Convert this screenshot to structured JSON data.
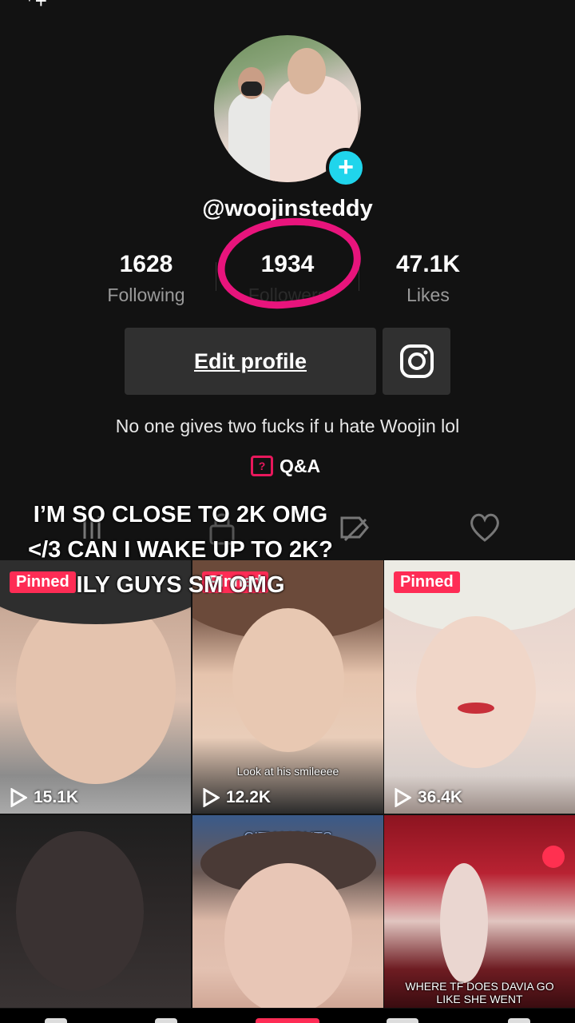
{
  "profile": {
    "username": "@woojinsteddy",
    "bio": "No one gives two fucks if u hate Woojin lol",
    "qa_label": "Q&A",
    "edit_profile_label": "Edit profile"
  },
  "stats": {
    "following": {
      "value": "1628",
      "label": "Following"
    },
    "followers": {
      "value": "1934",
      "label": "Followers"
    },
    "likes": {
      "value": "47.1K",
      "label": "Likes"
    }
  },
  "overlay_caption": "I’M SO CLOSE TO 2K OMG </3 CAN I WAKE UP TO 2K? ILY GUYS SM OMG",
  "tabs": [
    {
      "name": "videos-grid-icon"
    },
    {
      "name": "private-lock-icon"
    },
    {
      "name": "hidden-eye-icon"
    },
    {
      "name": "liked-heart-icon"
    }
  ],
  "videos": [
    {
      "pinned_label": "Pinned",
      "views": "15.1K",
      "caption": ""
    },
    {
      "pinned_label": "Pinned",
      "views": "12.2K",
      "caption": "Look at his smileeee"
    },
    {
      "pinned_label": "Pinned",
      "views": "36.4K",
      "caption": ""
    },
    {
      "pinned_label": "",
      "views": "",
      "caption": ""
    },
    {
      "pinned_label": "",
      "views": "",
      "caption": "CITY LIGHTS"
    },
    {
      "pinned_label": "",
      "views": "",
      "caption": "WHERE TF DOES DAVIA GO LIKE SHE WENT"
    }
  ],
  "colors": {
    "background": "#121212",
    "accent_pink": "#fe2c55",
    "plus_teal": "#20d5ec",
    "marker_pink": "#e8147c"
  }
}
